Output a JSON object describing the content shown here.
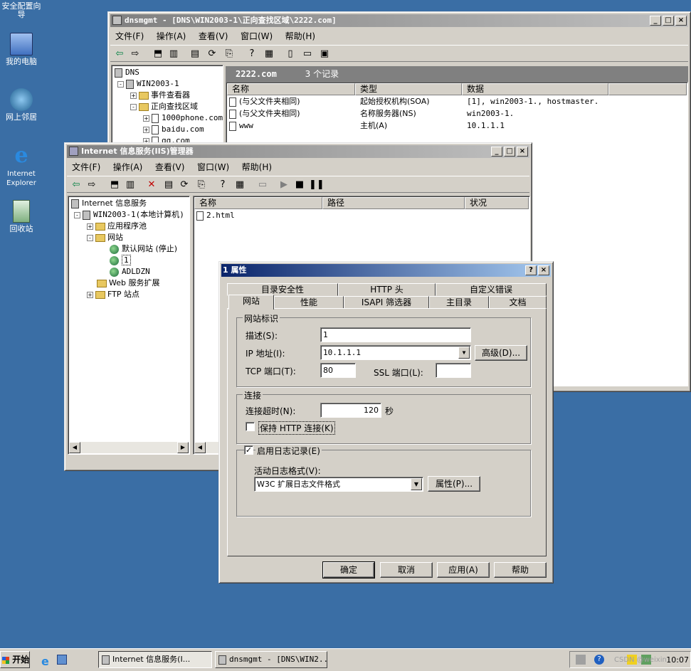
{
  "desktop": {
    "icons": [
      {
        "label": "安全配置向导",
        "icon": "security-wizard-icon"
      },
      {
        "label": "我的电脑",
        "icon": "computer-icon"
      },
      {
        "label": "网上邻居",
        "icon": "network-icon"
      },
      {
        "label": "Internet Explorer",
        "icon": "ie-icon"
      },
      {
        "label": "回收站",
        "icon": "recycle-bin-icon"
      }
    ]
  },
  "dns_window": {
    "title": "dnsmgmt - [DNS\\WIN2003-1\\正向查找区域\\2222.com]",
    "menu": [
      "文件(F)",
      "操作(A)",
      "查看(V)",
      "窗口(W)",
      "帮助(H)"
    ],
    "tree": [
      "DNS",
      "WIN2003-1",
      "事件查看器",
      "正向查找区域",
      "1000phone.com",
      "baidu.com",
      "qq.com"
    ],
    "zone_name": "2222.com",
    "record_count": "3 个记录",
    "columns": [
      "名称",
      "类型",
      "数据"
    ],
    "records": [
      {
        "name": "(与父文件夹相同)",
        "type": "起始授权机构(SOA)",
        "data": "[1], win2003-1., hostmaster."
      },
      {
        "name": "(与父文件夹相同)",
        "type": "名称服务器(NS)",
        "data": "win2003-1."
      },
      {
        "name": "www",
        "type": "主机(A)",
        "data": "10.1.1.1"
      }
    ]
  },
  "iis_window": {
    "title": "Internet 信息服务(IIS)管理器",
    "menu": [
      "文件(F)",
      "操作(A)",
      "查看(V)",
      "窗口(W)",
      "帮助(H)"
    ],
    "tree": [
      "Internet 信息服务",
      "WIN2003-1(本地计算机)",
      "应用程序池",
      "网站",
      "默认网站 (停止)",
      "1",
      "ADLDZN",
      "Web 服务扩展",
      "FTP 站点"
    ],
    "columns": [
      "名称",
      "路径",
      "状况"
    ],
    "files": [
      "2.html"
    ]
  },
  "properties_dialog": {
    "title": "1 属性",
    "tabs_back": [
      "目录安全性",
      "HTTP 头",
      "自定义错误"
    ],
    "tabs_front": [
      "网站",
      "性能",
      "ISAPI 筛选器",
      "主目录",
      "文档"
    ],
    "active_tab": "网站",
    "site_id_group": "网站标识",
    "description_label": "描述(S):",
    "description_value": "1",
    "ip_label": "IP 地址(I):",
    "ip_value": "10.1.1.1",
    "advanced_button": "高级(D)...",
    "tcp_port_label": "TCP 端口(T):",
    "tcp_port_value": "80",
    "ssl_port_label": "SSL 端口(L):",
    "ssl_port_value": "",
    "connection_group": "连接",
    "timeout_label": "连接超时(N):",
    "timeout_value": "120",
    "timeout_unit": "秒",
    "keepalive_label": "保持 HTTP 连接(K)",
    "keepalive_checked": false,
    "logging_label": "启用日志记录(E)",
    "logging_checked": true,
    "log_format_label": "活动日志格式(V):",
    "log_format_value": "W3C 扩展日志文件格式",
    "properties_button": "属性(P)...",
    "ok_button": "确定",
    "cancel_button": "取消",
    "apply_button": "应用(A)",
    "help_button": "帮助"
  },
  "taskbar": {
    "start_label": "开始",
    "tasks": [
      "Internet 信息服务(I...",
      "dnsmgmt - [DNS\\WIN2..."
    ],
    "clock": "10:07",
    "watermark": "CSDN @weixin"
  }
}
